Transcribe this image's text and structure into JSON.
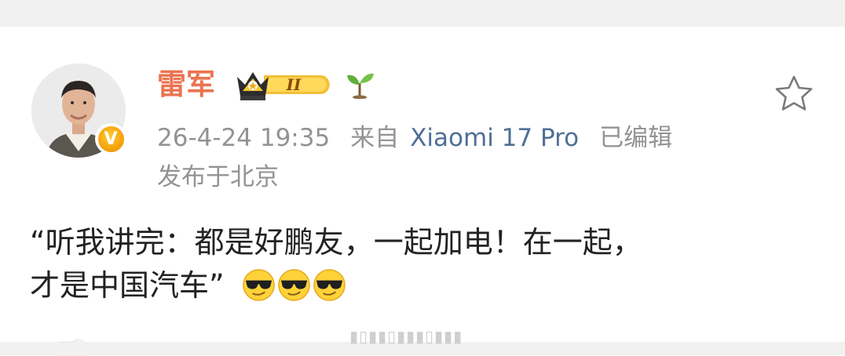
{
  "post": {
    "author": "雷军",
    "timestamp": "26-4-24 19:35",
    "source_prefix": "来自",
    "device": "Xiaomi 17 Pro",
    "edited": "已编辑",
    "location_prefix": "发布于",
    "location": "北京",
    "text_line1": "“听我讲完：都是好鹏友，一起加电！在一起，",
    "text_line2": "才是中国汽车”"
  },
  "badges": {
    "level_text": "II",
    "verified_mark": "V"
  },
  "icons": {
    "avatar": "avatar-photo",
    "verified": "verified-badge-icon",
    "crown": "crown-badge-icon",
    "sprout": "sprout-icon",
    "favorite": "star-outline-icon",
    "emoji": "sunglasses-emoji-icon"
  },
  "colors": {
    "username": "#eb7350",
    "meta": "#939393",
    "device_link": "#4f6f95",
    "text": "#222222",
    "background_band": "#f1f1f1"
  }
}
